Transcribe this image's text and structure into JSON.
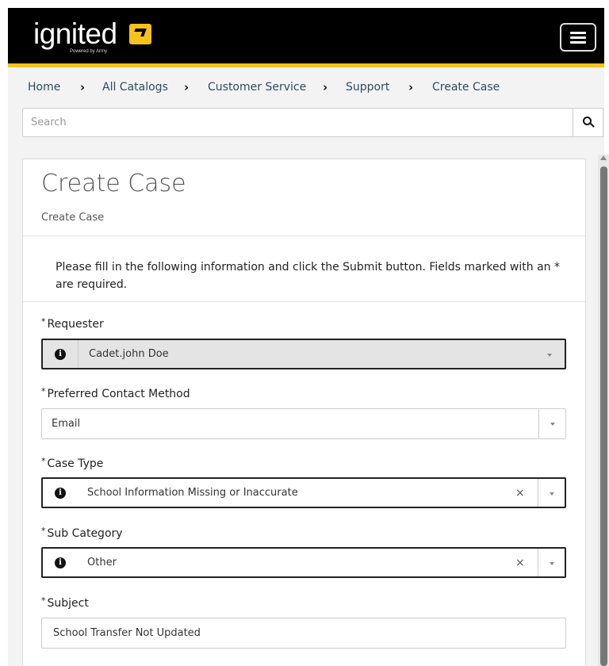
{
  "header": {
    "logo_text": "ignited",
    "logo_tagline": "Powered by Army",
    "menu_label": "Menu"
  },
  "colors": {
    "brand_black": "#000000",
    "brand_gold": "#f5c31a",
    "link": "#2d4a66"
  },
  "breadcrumb": [
    {
      "label": "Home"
    },
    {
      "label": "All Catalogs"
    },
    {
      "label": "Customer Service"
    },
    {
      "label": "Support"
    },
    {
      "label": "Create Case"
    }
  ],
  "search": {
    "placeholder": "Search",
    "value": "",
    "button_icon": "search-icon"
  },
  "form": {
    "title": "Create Case",
    "subtitle": "Create Case",
    "instructions": "Please fill in the following information and click the Submit button. Fields marked with an * are required.",
    "required_marker": "*",
    "fields": {
      "requester": {
        "label": "Requester",
        "value": "Cadet.john Doe"
      },
      "contact_method": {
        "label": "Preferred Contact Method",
        "value": "Email"
      },
      "case_type": {
        "label": "Case Type",
        "value": "School Information Missing or Inaccurate"
      },
      "sub_category": {
        "label": "Sub Category",
        "value": "Other"
      },
      "subject": {
        "label": "Subject",
        "value": "School Transfer Not Updated"
      }
    },
    "clear_glyph": "×"
  }
}
